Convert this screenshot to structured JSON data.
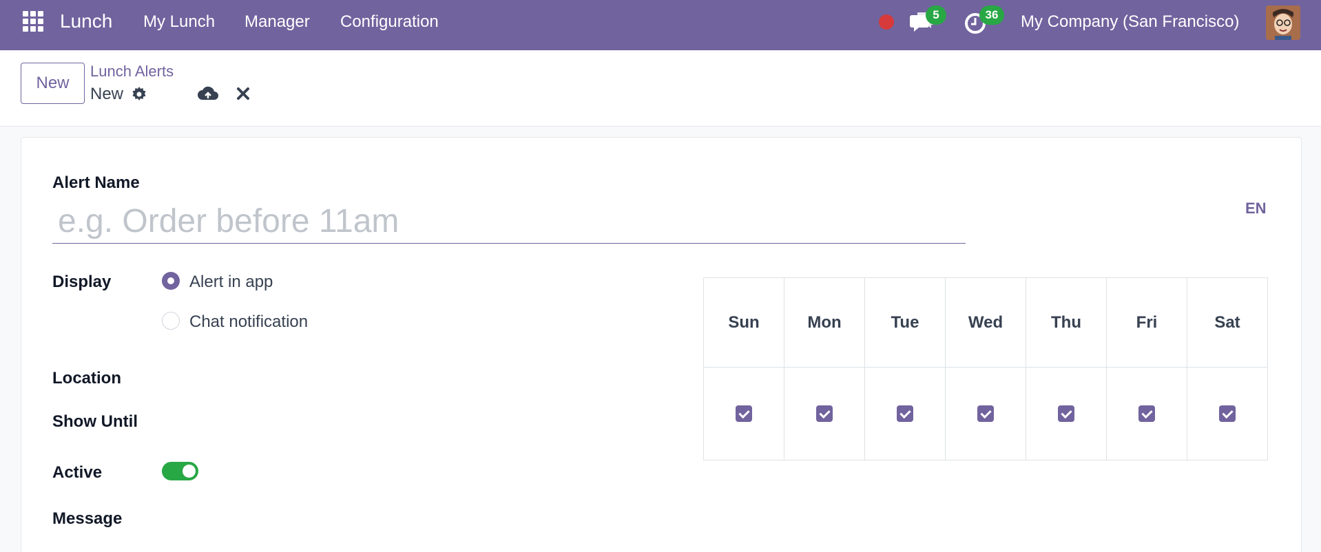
{
  "navbar": {
    "app_name": "Lunch",
    "menu": [
      "My Lunch",
      "Manager",
      "Configuration"
    ],
    "messages_count": "5",
    "activities_count": "36",
    "company": "My Company (San Francisco)",
    "brand_color": "#71639e"
  },
  "control_panel": {
    "new_button": "New",
    "breadcrumb": "Lunch Alerts",
    "record_name": "New"
  },
  "form": {
    "alert_name_label": "Alert Name",
    "alert_name_placeholder": "e.g. Order before 11am",
    "language": "EN",
    "display_label": "Display",
    "display_options": [
      {
        "label": "Alert in app",
        "selected": true
      },
      {
        "label": "Chat notification",
        "selected": false
      }
    ],
    "location_label": "Location",
    "show_until_label": "Show Until",
    "active_label": "Active",
    "active": true,
    "message_label": "Message",
    "days": [
      {
        "label": "Sun",
        "checked": true
      },
      {
        "label": "Mon",
        "checked": true
      },
      {
        "label": "Tue",
        "checked": true
      },
      {
        "label": "Wed",
        "checked": true
      },
      {
        "label": "Thu",
        "checked": true
      },
      {
        "label": "Fri",
        "checked": true
      },
      {
        "label": "Sat",
        "checked": true
      }
    ]
  }
}
